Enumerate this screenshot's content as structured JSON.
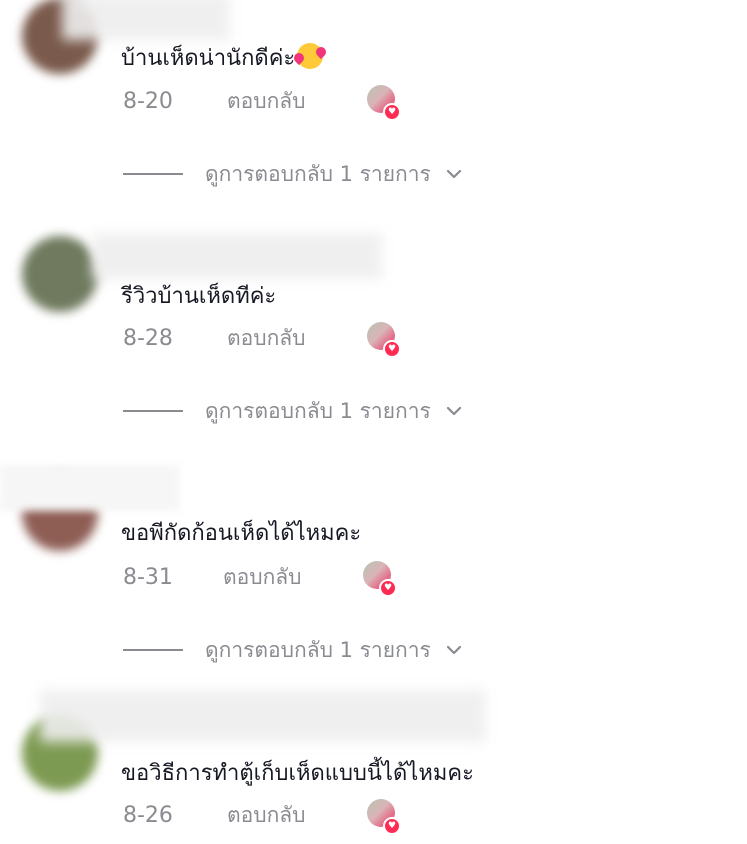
{
  "comments": [
    {
      "text": "บ้านเห็ดน่านักดีค่ะ",
      "emoji": "smiling-face-with-hearts",
      "date": "8-20",
      "reply_label": "ตอบกลับ",
      "view_replies": "ดูการตอบกลับ 1 รายการ",
      "avatar_color": "#7a5a4c"
    },
    {
      "text": "รีวิวบ้านเห็ดทีค่ะ",
      "date": "8-28",
      "reply_label": "ตอบกลับ",
      "view_replies": "ดูการตอบกลับ 1 รายการ",
      "avatar_color": "#6f7a5e"
    },
    {
      "text": "ขอพีกัดก้อนเห็ดได้ไหมคะ",
      "date": "8-31",
      "reply_label": "ตอบกลับ",
      "view_replies": "ดูการตอบกลับ 1 รายการ",
      "avatar_color": "#8e5e55"
    },
    {
      "text": "ขอวิธีการทำตู้เก็บเห็ดแบบนี้ได้ไหมคะ",
      "date": "8-26",
      "reply_label": "ตอบกลับ",
      "avatar_color": "#7d9a52"
    }
  ],
  "colors": {
    "text": "#161823",
    "muted": "#8a8b91",
    "like_badge": "#fe2c55"
  }
}
